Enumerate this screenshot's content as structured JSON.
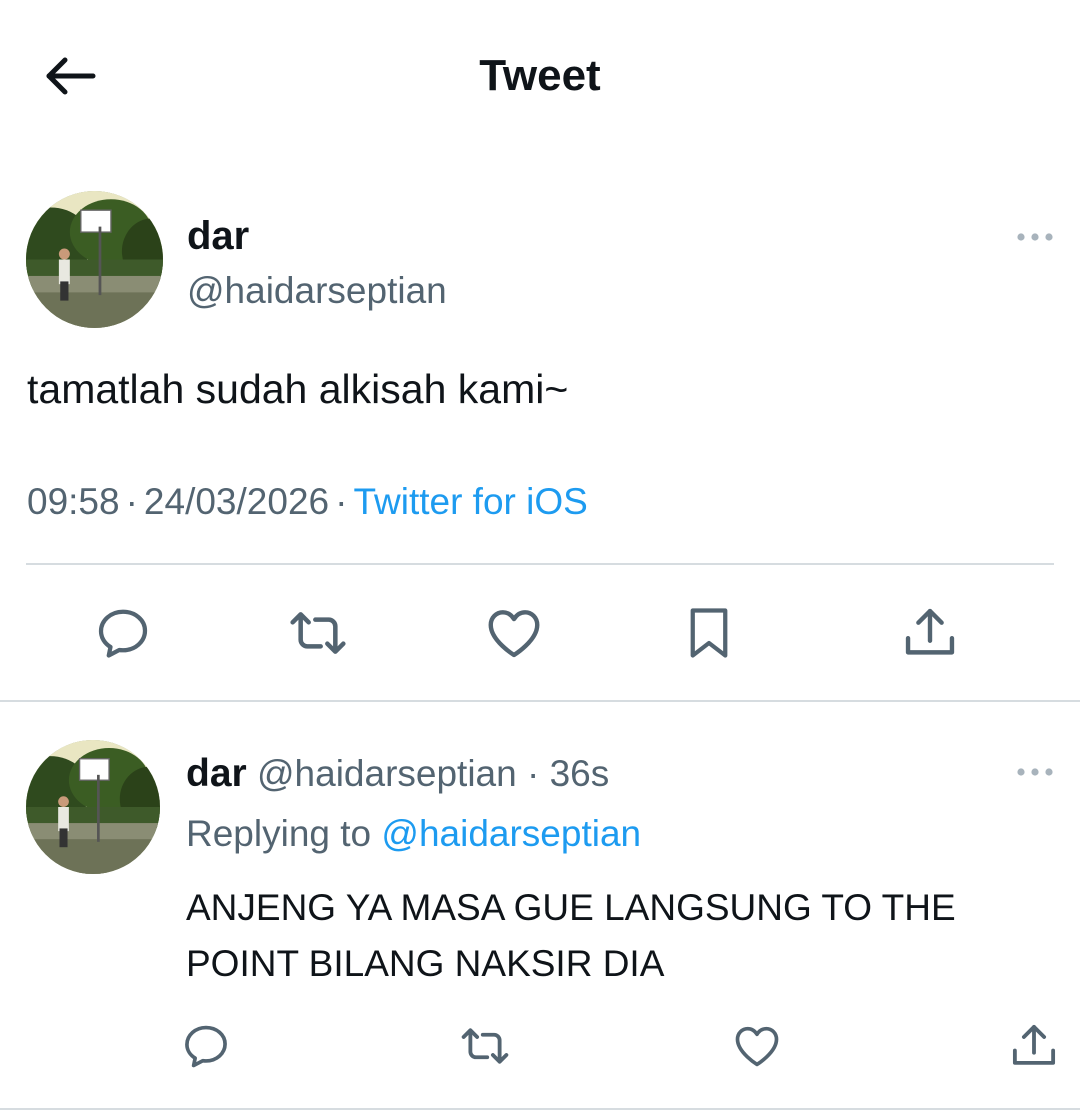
{
  "header": {
    "title": "Tweet",
    "back_icon": "arrow-left-icon"
  },
  "tweet": {
    "author_name": "dar",
    "author_handle": "@haidarseptian",
    "text": "tamatlah sudah alkisah kami~",
    "time": "09:58",
    "date": "24/03/2026",
    "source": "Twitter for iOS",
    "separator": "·",
    "more_icon": "more-dots-icon",
    "actions": [
      {
        "icon": "reply-icon"
      },
      {
        "icon": "retweet-icon"
      },
      {
        "icon": "like-icon"
      },
      {
        "icon": "bookmark-icon"
      },
      {
        "icon": "share-icon"
      }
    ]
  },
  "reply": {
    "author_name": "dar",
    "author_handle": "@haidarseptian",
    "separator": "·",
    "time_ago": "36s",
    "replying_prefix": "Replying to",
    "replying_handle": "@haidarseptian",
    "text": "ANJENG YA MASA GUE LANGSUNG TO THE POINT BILANG NAKSIR DIA",
    "actions": [
      {
        "icon": "reply-icon"
      },
      {
        "icon": "retweet-icon"
      },
      {
        "icon": "like-icon"
      },
      {
        "icon": "share-icon"
      }
    ]
  },
  "colors": {
    "text_primary": "#0f1419",
    "text_secondary": "#536471",
    "link": "#1d9bf0",
    "divider": "#d6dce0"
  }
}
